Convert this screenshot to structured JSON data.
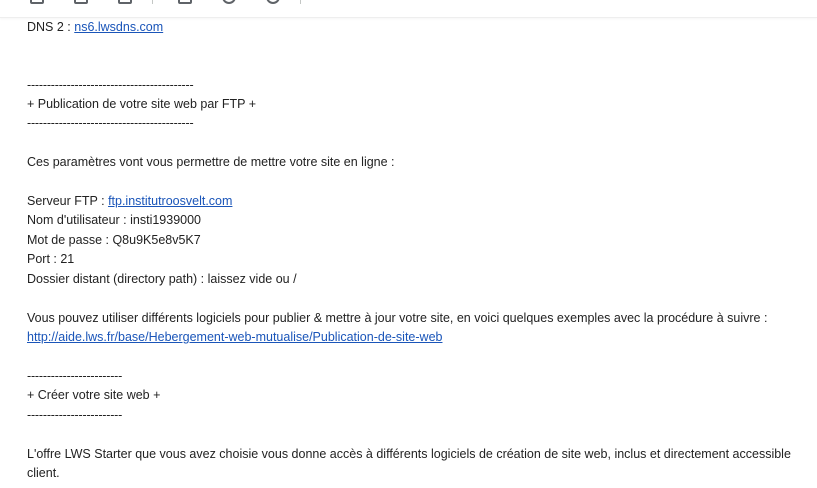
{
  "email": {
    "dns2_label": "DNS 2 :",
    "dns2_value": "ns6.lwsdns.com",
    "ftp_section": {
      "divider": "------------------------------------------",
      "title": "+ Publication de votre site web par FTP +",
      "intro": "Ces paramètres vont vous permettre de mettre votre site en ligne :",
      "server_label": "Serveur FTP :",
      "server_value": "ftp.institutroosvelt.com",
      "username": "Nom d'utilisateur : insti1939000",
      "password": "Mot de passe : Q8u9K5e8v5K7",
      "port": "Port : 21",
      "remote_dir": "Dossier distant (directory path) : laissez vide ou /",
      "software_text": "Vous pouvez utiliser différents logiciels pour publier & mettre à jour votre site, en voici quelques exemples avec la procédure à suivre :",
      "help_link": "http://aide.lws.fr/base/Hebergement-web-mutualise/Publication-de-site-web"
    },
    "create_section": {
      "divider": "------------------------",
      "title": "+ Créer votre site web +",
      "offer_text": "L'offre LWS Starter que vous avez choisie vous donne accès à différents logiciels de création de site web, inclus et directement accessible",
      "offer_text_end": "client."
    }
  },
  "colors": {
    "link": "#1a55b9",
    "text": "#222222",
    "background": "#ffffff"
  }
}
